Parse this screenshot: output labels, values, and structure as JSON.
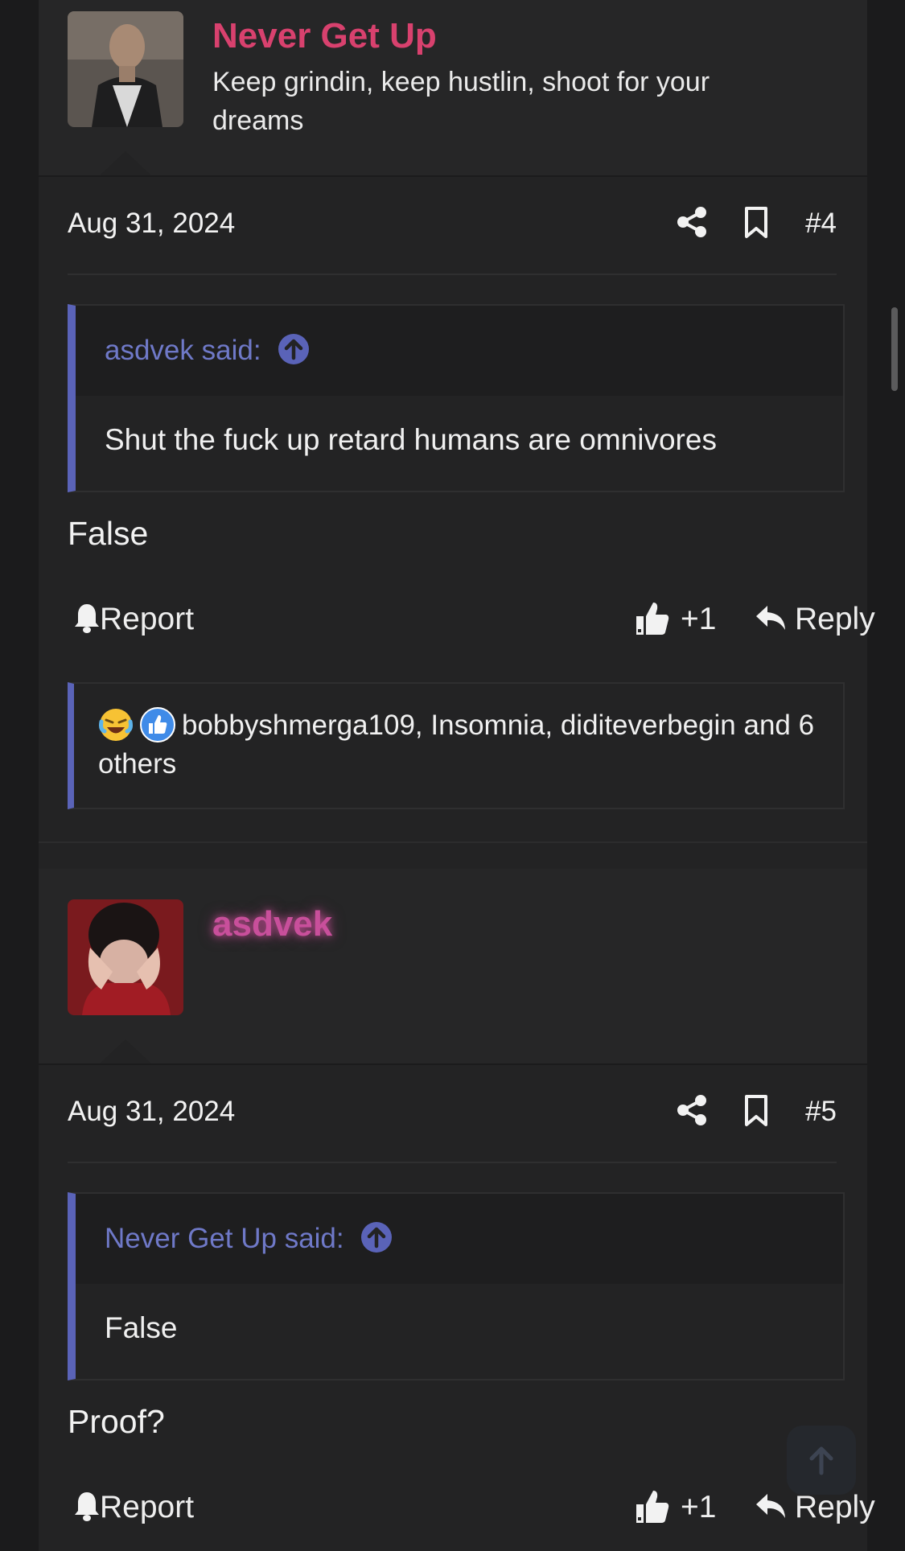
{
  "posts": [
    {
      "username": "Never Get Up",
      "username_color": "#d8416e",
      "user_title": "Keep grindin, keep hustlin, shoot for your dreams",
      "date": "Aug 31, 2024",
      "post_number": "#4",
      "quote": {
        "author": "asdvek said:",
        "text": "Shut the fuck up retard humans are omnivores"
      },
      "body": "False",
      "report_label": "Report",
      "like_count": "+1",
      "reply_label": "Reply",
      "reactions_text": "bobbyshmerga109, Insomnia, diditeverbegin and 6 others"
    },
    {
      "username": "asdvek",
      "username_color": "#c84f9b",
      "user_title": "",
      "date": "Aug 31, 2024",
      "post_number": "#5",
      "quote": {
        "author": "Never Get Up said:",
        "text": "False"
      },
      "body": "Proof?",
      "report_label": "Report",
      "like_count": "+1",
      "reply_label": "Reply"
    }
  ],
  "icons": {
    "share": "share-icon",
    "bookmark": "bookmark-icon",
    "quote_jump": "arrow-up-circle-icon",
    "report": "bell-icon",
    "like": "thumbs-up-icon",
    "reply": "reply-arrow-icon",
    "scroll_top": "arrow-up-icon"
  },
  "colors": {
    "accent": "#5a63b8",
    "quote_author": "#6f79c8",
    "background": "#232324"
  }
}
